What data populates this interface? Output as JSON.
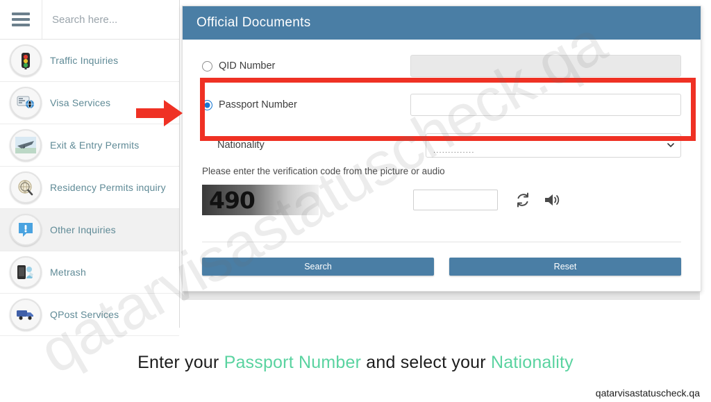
{
  "watermark": {
    "text": "qatarvisastatuscheck.qa"
  },
  "sidebar": {
    "search_placeholder": "Search here...",
    "menu_icon": "hamburger-menu-icon",
    "items": [
      {
        "label": "Traffic Inquiries",
        "icon": "traffic-light-icon",
        "active": false
      },
      {
        "label": "Visa Services",
        "icon": "visa-globe-icon",
        "active": false
      },
      {
        "label": "Exit & Entry Permits",
        "icon": "airplane-icon",
        "active": false
      },
      {
        "label": "Residency Permits inquiry",
        "icon": "magnifier-globe-icon",
        "active": false
      },
      {
        "label": "Other Inquiries",
        "icon": "exclamation-bubble-icon",
        "active": true
      },
      {
        "label": "Metrash",
        "icon": "mobile-device-icon",
        "active": false
      },
      {
        "label": "QPost Services",
        "icon": "delivery-truck-icon",
        "active": false
      }
    ]
  },
  "annotation": {
    "arrow_icon": "red-right-arrow-icon",
    "highlight_color": "#ef3124"
  },
  "panel": {
    "title": "Official Documents",
    "header_color": "#4a7ea5",
    "fields": {
      "qid": {
        "label": "QID Number",
        "selected": false,
        "value": "",
        "disabled": true
      },
      "passport": {
        "label": "Passport Number",
        "selected": true,
        "value": "",
        "disabled": false
      },
      "nationality": {
        "label": "Nationality",
        "value": "..............",
        "chevron_icon": "chevron-down-icon"
      }
    },
    "captcha": {
      "hint": "Please enter the verification code from the picture or audio",
      "code": "490",
      "input_value": "",
      "refresh_icon": "refresh-icon",
      "audio_icon": "speaker-icon"
    },
    "buttons": {
      "search": "Search",
      "reset": "Reset"
    }
  },
  "caption": {
    "part1": "Enter your ",
    "highlight1": "Passport Number",
    "part2": " and select your ",
    "highlight2": "Nationality",
    "highlight_color": "#5ad3a0"
  },
  "footer": {
    "site": "qatarvisastatuscheck.qa"
  }
}
